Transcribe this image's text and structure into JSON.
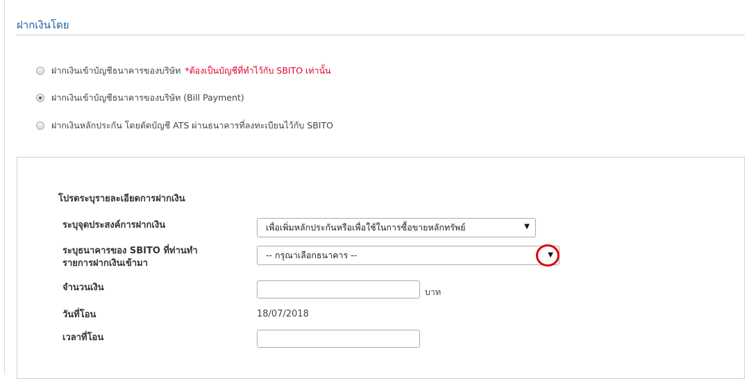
{
  "section": {
    "title": "ฝากเงินโดย"
  },
  "options": [
    {
      "label": "ฝากเงินเข้าบัญชีธนาคารของบริษัท",
      "note": "*ต้องเป็นบัญชีที่ทำไว้กับ SBITO เท่านั้น",
      "checked": false
    },
    {
      "label": "ฝากเงินเข้าบัญชีธนาคารของบริษัท (Bill Payment)",
      "note": "",
      "checked": true
    },
    {
      "label": "ฝากเงินหลักประกัน โดยตัดบัญชี ATS ผ่านธนาคารที่ลงทะเบียนไว้กับ SBITO",
      "note": "",
      "checked": false
    }
  ],
  "form": {
    "heading": "โปรดระบุรายละเอียดการฝากเงิน",
    "purpose": {
      "label": "ระบุจุดประสงค์การฝากเงิน",
      "selected": "เพื่อเพิ่มหลักประกันหรือเพื่อใช้ในการซื้อขายหลักทรัพย์"
    },
    "bank": {
      "label_line1": "ระบุธนาคารของ SBITO ที่ท่านทำ",
      "label_line2": "รายการฝากเงินเข้ามา",
      "selected": "-- กรุณาเลือกธนาคาร --"
    },
    "amount": {
      "label": "จำนวนเงิน",
      "value": "",
      "unit": "บาท"
    },
    "transfer_date": {
      "label": "วันที่โอน",
      "value": "18/07/2018"
    },
    "transfer_time": {
      "label": "เวลาที่โอน",
      "value": ""
    }
  },
  "dropdown_arrow_glyph": "▼",
  "colors": {
    "title": "#1f5f9f",
    "note": "#e0002a",
    "highlight": "#e00000"
  }
}
